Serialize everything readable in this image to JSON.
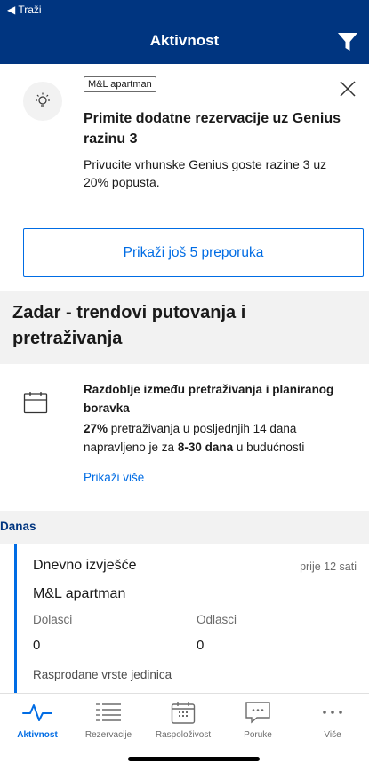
{
  "status": {
    "back_label": "◀ Traži"
  },
  "header": {
    "title": "Aktivnost",
    "filter_icon": "filter-icon"
  },
  "recommendation": {
    "tag": "M&L apartman",
    "title": "Primite dodatne rezervacije uz Genius razinu 3",
    "description": "Privucite vrhunske Genius goste razine 3 uz 20% popusta.",
    "more_button": "Prikaži još 5 preporuka"
  },
  "trends": {
    "title": "Zadar - trendovi putovanja i pretraživanja",
    "card_title": "Razdoblje između pretraživanja i planiranog boravka",
    "desc_pct": "27%",
    "desc_mid": " pretraživanja u posljednjih 14 dana napravljeno je za ",
    "desc_days": "8-30 dana",
    "desc_end": " u budućnosti",
    "show_more": "Prikaži više"
  },
  "today": {
    "label": "Danas",
    "report_title": "Dnevno izvješće",
    "report_time": "prije 12 sati",
    "property": "M&L apartman",
    "arrivals_label": "Dolasci",
    "arrivals_value": "0",
    "departures_label": "Odlasci",
    "departures_value": "0",
    "sold_out_label": "Rasprodane vrste jedinica"
  },
  "tabs": [
    {
      "label": "Aktivnost",
      "icon": "activity-icon",
      "active": true
    },
    {
      "label": "Rezervacije",
      "icon": "list-icon",
      "active": false
    },
    {
      "label": "Raspoloživost",
      "icon": "calendar-icon",
      "active": false
    },
    {
      "label": "Poruke",
      "icon": "message-icon",
      "active": false
    },
    {
      "label": "Više",
      "icon": "more-icon",
      "active": false
    }
  ],
  "colors": {
    "brand": "#003580",
    "accent": "#006ce4",
    "muted": "#6b6b6b"
  }
}
